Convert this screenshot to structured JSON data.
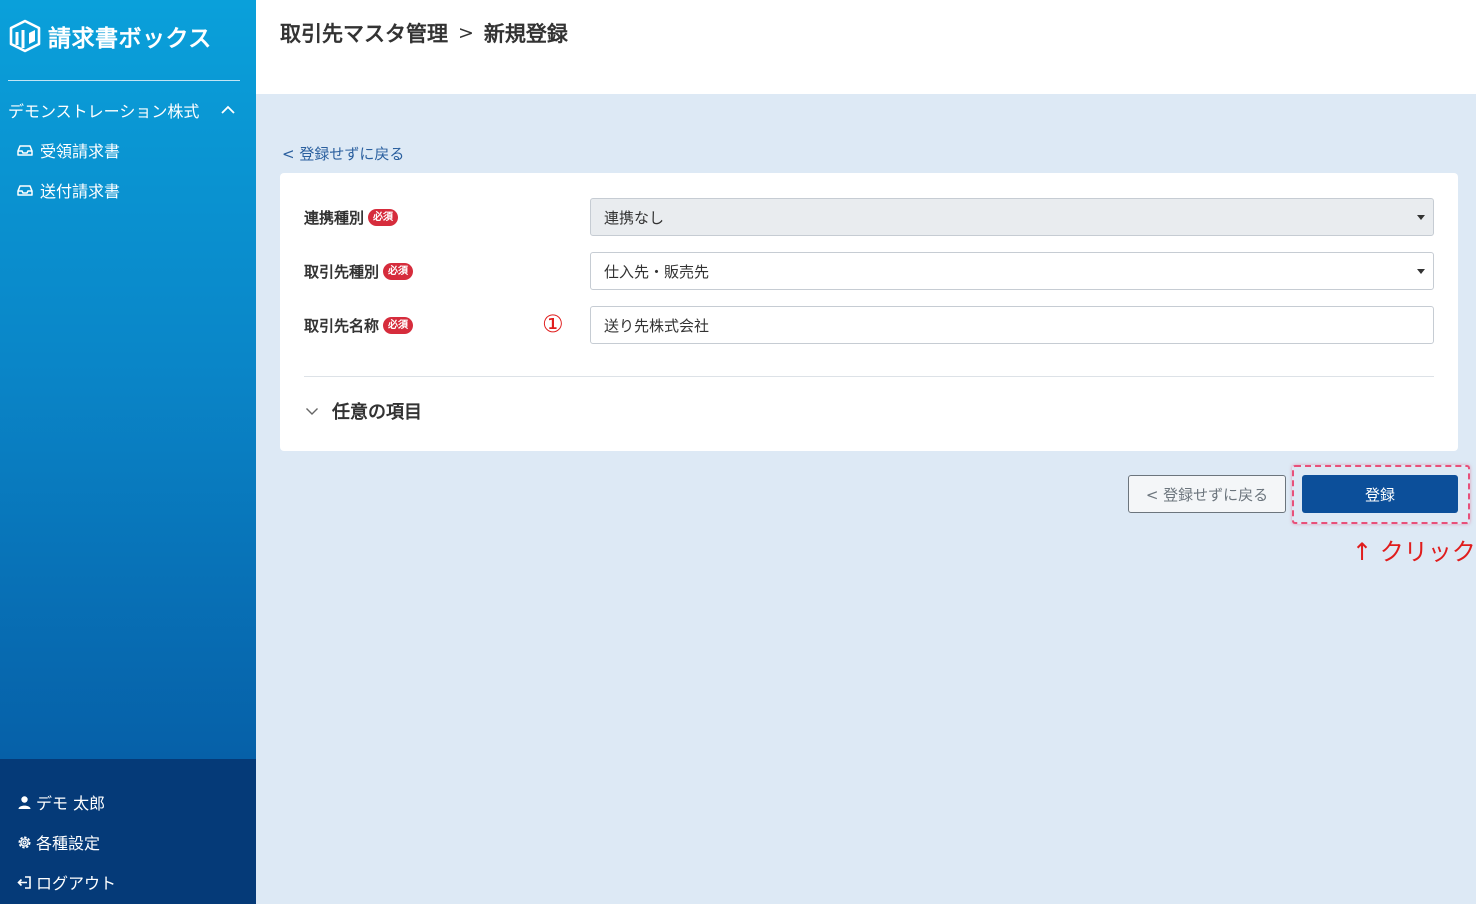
{
  "app": {
    "name": "請求書ボックス"
  },
  "sidebar": {
    "company": "デモンストレーション株式",
    "items": [
      {
        "label": "受領請求書",
        "icon": "inbox-icon"
      },
      {
        "label": "送付請求書",
        "icon": "inbox-icon"
      }
    ],
    "bottom": [
      {
        "label": "デモ 太郎",
        "icon": "user-icon"
      },
      {
        "label": "各種設定",
        "icon": "gear-icon"
      },
      {
        "label": "ログアウト",
        "icon": "logout-icon"
      }
    ]
  },
  "header": {
    "breadcrumb": {
      "parent": "取引先マスタ管理",
      "separator": ">",
      "current": "新規登録"
    }
  },
  "back_link": "< 登録せずに戻る",
  "form": {
    "fields": [
      {
        "label": "連携種別",
        "required": "必須",
        "value": "連携なし",
        "type": "select",
        "disabled": true
      },
      {
        "label": "取引先種別",
        "required": "必須",
        "value": "仕入先・販売先",
        "type": "select"
      },
      {
        "label": "取引先名称",
        "required": "必須",
        "value": "送り先株式会社",
        "type": "text"
      }
    ],
    "annotation_number": "①",
    "optional_section": "任意の項目"
  },
  "buttons": {
    "back": "< 登録せずに戻る",
    "submit": "登録"
  },
  "annotation": "↑ クリック",
  "colors": {
    "sidebar_top": "#0aa0da",
    "sidebar_bottom": "#053a78",
    "primary": "#0c4f9a",
    "required_badge": "#d62c3c",
    "annotation": "#e01d1d",
    "background": "#dde9f5"
  }
}
